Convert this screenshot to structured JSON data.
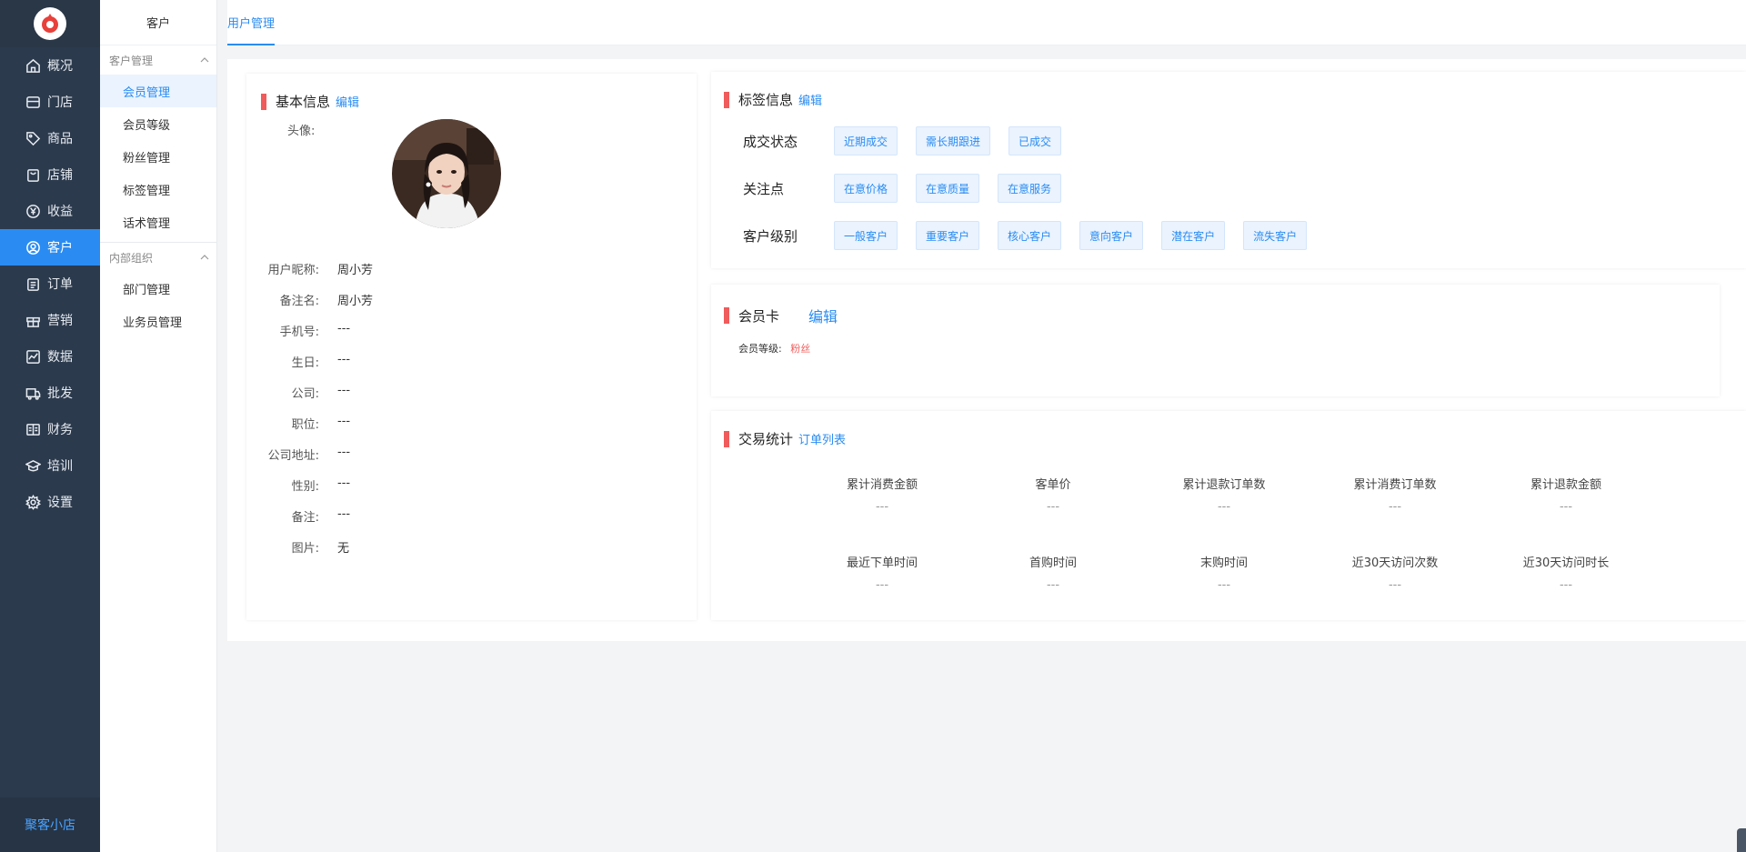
{
  "sidebar": {
    "items": [
      {
        "label": "概况",
        "icon": "home-icon"
      },
      {
        "label": "门店",
        "icon": "store-icon"
      },
      {
        "label": "商品",
        "icon": "tag-icon"
      },
      {
        "label": "店铺",
        "icon": "shop-bag-icon"
      },
      {
        "label": "收益",
        "icon": "yuan-icon"
      },
      {
        "label": "客户",
        "icon": "user-icon",
        "active": true
      },
      {
        "label": "订单",
        "icon": "clipboard-icon"
      },
      {
        "label": "营销",
        "icon": "gift-icon"
      },
      {
        "label": "数据",
        "icon": "chart-icon"
      },
      {
        "label": "批发",
        "icon": "truck-icon"
      },
      {
        "label": "财务",
        "icon": "ledger-icon"
      },
      {
        "label": "培训",
        "icon": "graduation-icon"
      },
      {
        "label": "设置",
        "icon": "gear-icon"
      }
    ],
    "brand": "聚客小店"
  },
  "subside": {
    "title": "客户",
    "groups": [
      {
        "title": "客户管理",
        "items": [
          "会员管理",
          "会员等级",
          "粉丝管理",
          "标签管理",
          "话术管理"
        ]
      },
      {
        "title": "内部组织",
        "items": [
          "部门管理",
          "业务员管理"
        ]
      }
    ]
  },
  "tabs": {
    "active": "用户管理"
  },
  "basic": {
    "title": "基本信息",
    "edit": "编辑",
    "avatar_label": "头像:",
    "rows": [
      {
        "label": "用户昵称:",
        "value": "周小芳"
      },
      {
        "label": "备注名:",
        "value": "周小芳"
      },
      {
        "label": "手机号:",
        "value": "---"
      },
      {
        "label": "生日:",
        "value": "---"
      },
      {
        "label": "公司:",
        "value": "---"
      },
      {
        "label": "职位:",
        "value": "---"
      },
      {
        "label": "公司地址:",
        "value": "---"
      },
      {
        "label": "性别:",
        "value": "---"
      },
      {
        "label": "备注:",
        "value": "---"
      },
      {
        "label": "图片:",
        "value": "无"
      }
    ]
  },
  "tags": {
    "title": "标签信息",
    "edit": "编辑",
    "rows": [
      {
        "label": "成交状态",
        "tags": [
          "近期成交",
          "需长期跟进",
          "已成交"
        ]
      },
      {
        "label": "关注点",
        "tags": [
          "在意价格",
          "在意质量",
          "在意服务"
        ]
      },
      {
        "label": "客户级别",
        "tags": [
          "一般客户",
          "重要客户",
          "核心客户",
          "意向客户",
          "潜在客户",
          "流失客户"
        ]
      }
    ]
  },
  "member": {
    "title": "会员卡",
    "edit": "编辑",
    "level_label": "会员等级:",
    "level_value": "粉丝"
  },
  "stats": {
    "title": "交易统计",
    "link": "订单列表",
    "items": [
      {
        "label": "累计消费金额",
        "value": "---"
      },
      {
        "label": "客单价",
        "value": "---"
      },
      {
        "label": "累计退款订单数",
        "value": "---"
      },
      {
        "label": "累计消费订单数",
        "value": "---"
      },
      {
        "label": "累计退款金额",
        "value": "---"
      },
      {
        "label": "最近下单时间",
        "value": "---"
      },
      {
        "label": "首购时间",
        "value": "---"
      },
      {
        "label": "末购时间",
        "value": "---"
      },
      {
        "label": "近30天访问次数",
        "value": "---"
      },
      {
        "label": "近30天访问时长",
        "value": "---"
      }
    ]
  },
  "colors": {
    "accent": "#2a8cf2",
    "sidebar_bg": "#2c3a4d",
    "marker": "#f05b5b",
    "tag_bg": "#eaf3fe"
  }
}
